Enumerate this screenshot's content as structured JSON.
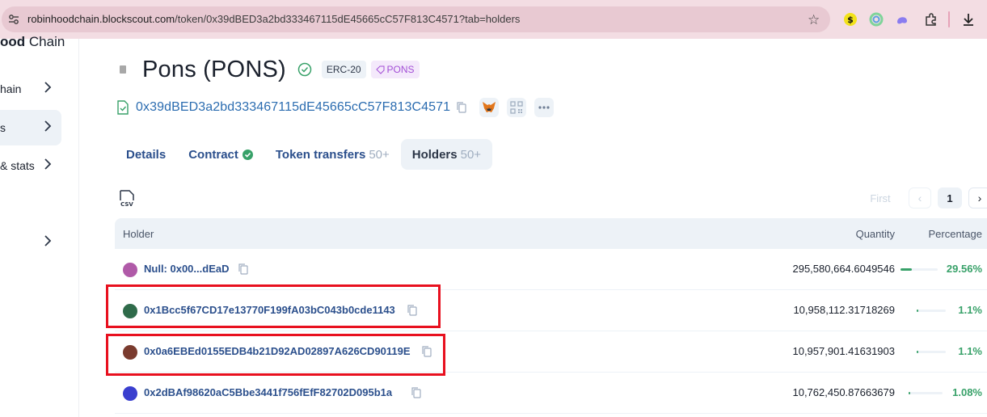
{
  "browser": {
    "url_host": "robinhoodchain.blockscout.com",
    "url_path": "/token/0x39dBED3a2bd333467115dE45665cC57F813C4571?tab=holders"
  },
  "sidebar": {
    "brand_bold": "ood",
    "brand_rest": " Chain",
    "items": [
      {
        "label": "hain",
        "active": false
      },
      {
        "label": "s",
        "active": true
      },
      {
        "label": "& stats",
        "active": false
      },
      {
        "label": "",
        "active": false
      }
    ]
  },
  "token": {
    "title": "Pons (PONS)",
    "standard_badge": "ERC-20",
    "tag_badge": "PONS",
    "address": "0x39dBED3a2bd333467115dE45665cC57F813C4571"
  },
  "tabs": [
    {
      "label": "Details",
      "count": ""
    },
    {
      "label": "Contract",
      "count": ""
    },
    {
      "label": "Token transfers",
      "count": "50+"
    },
    {
      "label": "Holders",
      "count": "50+"
    }
  ],
  "pagination": {
    "first_label": "First",
    "current_page": "1"
  },
  "table": {
    "headers": {
      "holder": "Holder",
      "quantity": "Quantity",
      "percentage": "Percentage"
    },
    "rows": [
      {
        "holder": "Null: 0x00...dEaD",
        "quantity": "295,580,664.6049546",
        "percentage": "29.56%",
        "share": 0.2956
      },
      {
        "holder": "0x1Bcc5f67CD17e13770F199fA03bC043b0cde1143",
        "quantity": "10,958,112.31718269",
        "percentage": "1.1%",
        "share": 0.011
      },
      {
        "holder": "0x0a6EBEd0155EDB4b21D92AD02897A626CD90119E",
        "quantity": "10,957,901.41631903",
        "percentage": "1.1%",
        "share": 0.011
      },
      {
        "holder": "0x2dBAf98620aC5Bbe3441f756fEfF82702D095b1a",
        "quantity": "10,762,450.87663679",
        "percentage": "1.08%",
        "share": 0.0108
      }
    ]
  },
  "colors": {
    "link": "#2b4f8c",
    "success": "#38a169",
    "highlight": "#e8101f"
  }
}
